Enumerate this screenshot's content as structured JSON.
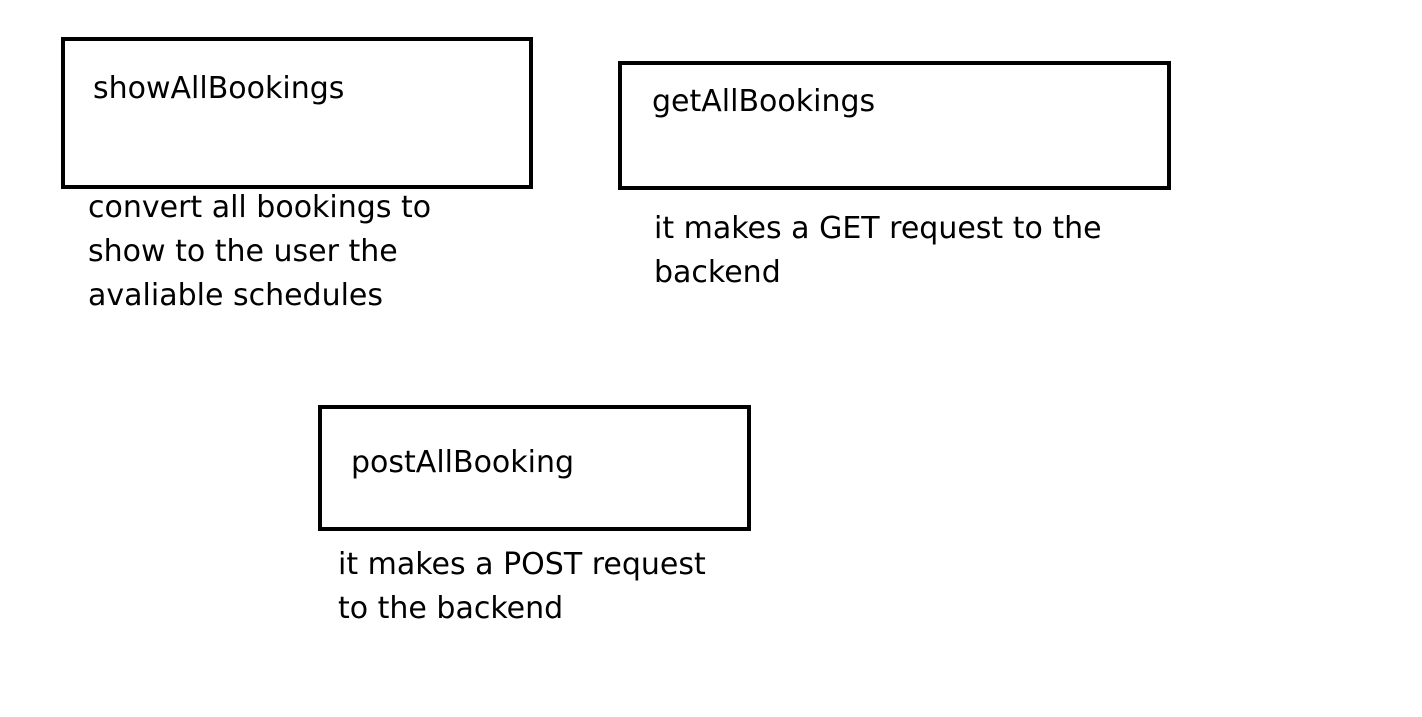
{
  "nodes": [
    {
      "title": "showAllBookings",
      "description": [
        "convert all bookings to",
        "show to the user the",
        "avaliable schedules"
      ]
    },
    {
      "title": "getAllBookings",
      "description": [
        "it makes a GET request to the",
        "backend"
      ]
    },
    {
      "title": "postAllBooking",
      "description": [
        "it makes a POST request",
        "to the backend"
      ]
    }
  ]
}
